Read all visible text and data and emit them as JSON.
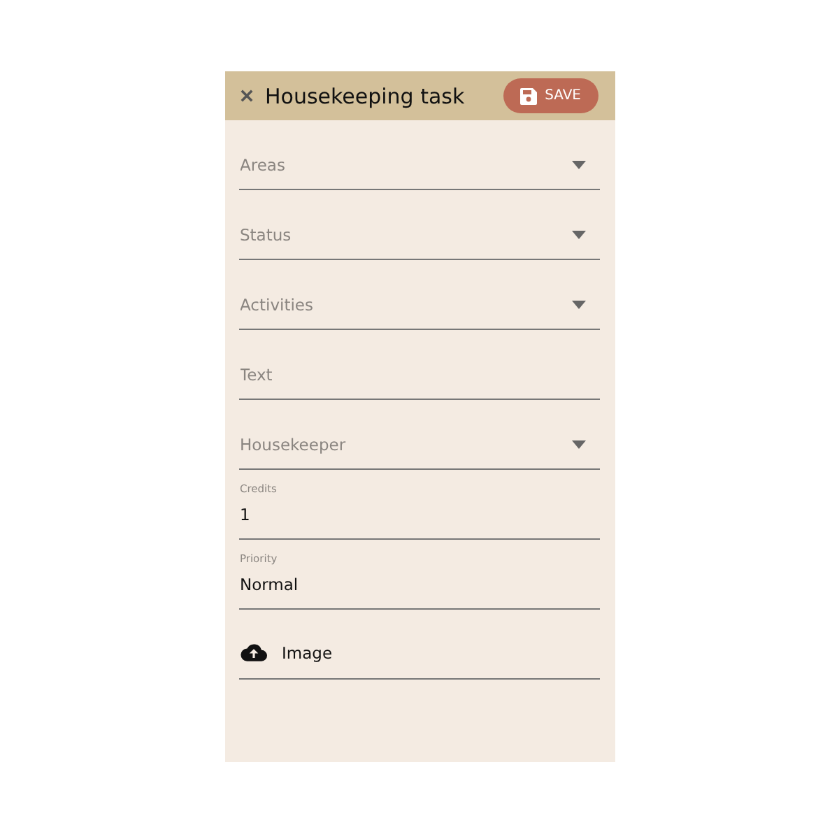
{
  "header": {
    "title": "Housekeeping task",
    "save_label": "SAVE"
  },
  "fields": [
    {
      "kind": "select",
      "placeholder": "Areas"
    },
    {
      "kind": "select",
      "placeholder": "Status"
    },
    {
      "kind": "select",
      "placeholder": "Activities"
    },
    {
      "kind": "text",
      "placeholder": "Text"
    },
    {
      "kind": "select",
      "placeholder": "Housekeeper"
    },
    {
      "kind": "filled",
      "label": "Credits",
      "value": "1"
    },
    {
      "kind": "filled",
      "label": "Priority",
      "value": "Normal"
    },
    {
      "kind": "upload",
      "label": "Image"
    }
  ]
}
